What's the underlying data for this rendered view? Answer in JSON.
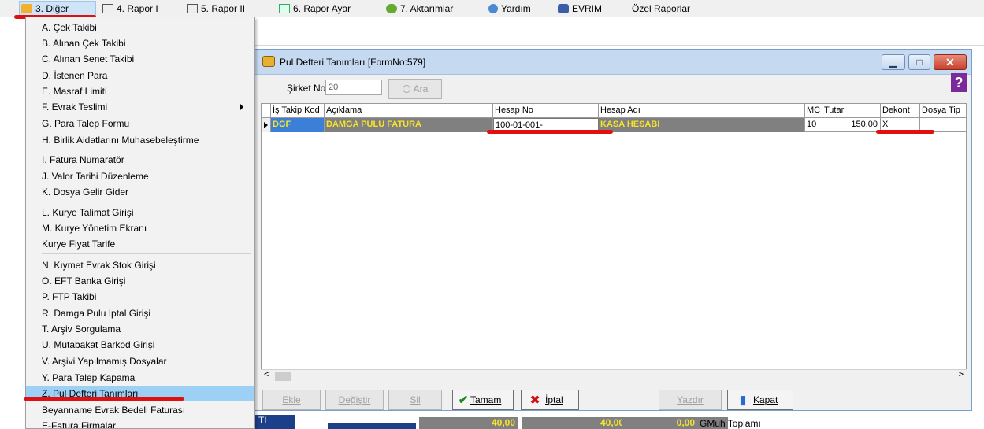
{
  "menubar": {
    "items": [
      {
        "label": "3. Diğer",
        "icon": "folder-gear-icon"
      },
      {
        "label": "4.  Rapor I",
        "icon": "printer-icon"
      },
      {
        "label": "5.  Rapor II",
        "icon": "printer-icon"
      },
      {
        "label": "6.  Rapor Ayar",
        "icon": "report-settings-icon"
      },
      {
        "label": "7.  Aktarımlar",
        "icon": "transfer-icon"
      },
      {
        "label": "Yardım",
        "icon": "help-icon"
      },
      {
        "label": "EVRIM",
        "icon": "evrim-logo-icon"
      },
      {
        "label": "Özel Raporlar",
        "icon": ""
      }
    ]
  },
  "dropdown": {
    "items": [
      {
        "label": "A.  Çek Takibi"
      },
      {
        "label": "B.  Alınan Çek Takibi"
      },
      {
        "label": "C.  Alınan Senet Takibi"
      },
      {
        "label": "D.  İstenen Para"
      },
      {
        "label": "E.  Masraf Limiti"
      },
      {
        "label": "F.  Evrak Teslimi"
      },
      {
        "label": "G.  Para Talep Formu"
      },
      {
        "label": "H.  Birlik Aidatlarını Muhasebeleştirme"
      },
      {
        "label": "I.  Fatura Numaratör"
      },
      {
        "label": "J.  Valor Tarihi Düzenleme"
      },
      {
        "label": "K.  Dosya Gelir Gider"
      },
      {
        "label": "L.   Kurye Talimat Girişi"
      },
      {
        "label": "M.  Kurye Yönetim Ekranı"
      },
      {
        "label": "Kurye Fiyat Tarife"
      },
      {
        "label": "N.  Kıymet Evrak Stok Girişi"
      },
      {
        "label": "O.  EFT Banka Girişi"
      },
      {
        "label": "P.  FTP Takibi"
      },
      {
        "label": "R.  Damga Pulu İptal  Girişi"
      },
      {
        "label": "T. Arşiv Sorgulama"
      },
      {
        "label": "U. Mutabakat Barkod Girişi"
      },
      {
        "label": "V. Arşivi Yapılmamış Dosyalar"
      },
      {
        "label": "Y.  Para Talep Kapama"
      },
      {
        "label": "Z. Pul Defteri Tanımları"
      },
      {
        "label": "Beyanname Evrak Bedeli Faturası"
      },
      {
        "label": "E-Fatura Firmalar"
      }
    ]
  },
  "dialog": {
    "title": "Pul Defteri Tanımları [FormNo:579]",
    "sirket_label": "Şirket No",
    "sirket_value": "20",
    "ara_label": "Ara",
    "help_label": "?",
    "columns": [
      "İş Takip Kod",
      "Açıklama",
      "Hesap No",
      "Hesap Adı",
      "MC",
      "Tutar",
      "Dekont",
      "Dosya Tip"
    ],
    "row": {
      "is_takip_kod": "DGF",
      "aciklama": "DAMGA PULU FATURA",
      "hesap_no": "100-01-001-",
      "hesap_adi": "KASA HESABI",
      "mc": "10",
      "tutar": "150,00",
      "dekont": "X",
      "dosya_tip": ""
    },
    "buttons": {
      "ekle": "Ekle",
      "degistir": "Değiştir",
      "sil": "Sil",
      "tamam": "Tamam",
      "iptal": "İptal",
      "yazdir": "Yazdır",
      "kapat": "Kapat"
    }
  },
  "bottom": {
    "box1": "40,00",
    "box2": "40,00",
    "box3": "0,00",
    "label": "GMuh Toplamı",
    "tl": "TL"
  },
  "colors": {
    "highlight_row_bg": "#808080",
    "highlight_row_text": "#f7e32a",
    "annotation_red": "#e01010",
    "menu_selected": "#9cd0f5"
  }
}
